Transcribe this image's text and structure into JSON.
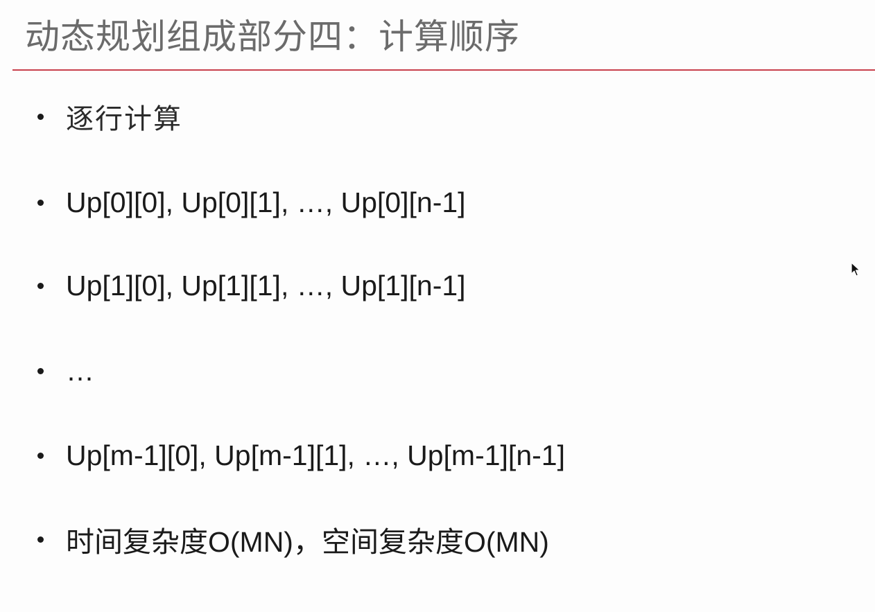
{
  "title": "动态规划组成部分四：计算顺序",
  "bullets": [
    "逐行计算",
    "Up[0][0], Up[0][1], …, Up[0][n-1]",
    "Up[1][0], Up[1][1], …, Up[1][n-1]",
    "…",
    "Up[m-1][0], Up[m-1][1], …, Up[m-1][n-1]",
    "时间复杂度O(MN)，空间复杂度O(MN)"
  ],
  "colors": {
    "title": "#6b6b6b",
    "rule": "#c8404c",
    "text": "#1a1a1a",
    "background": "#fdfdfd"
  },
  "icons": {
    "cursor": "mouse-pointer-icon"
  }
}
